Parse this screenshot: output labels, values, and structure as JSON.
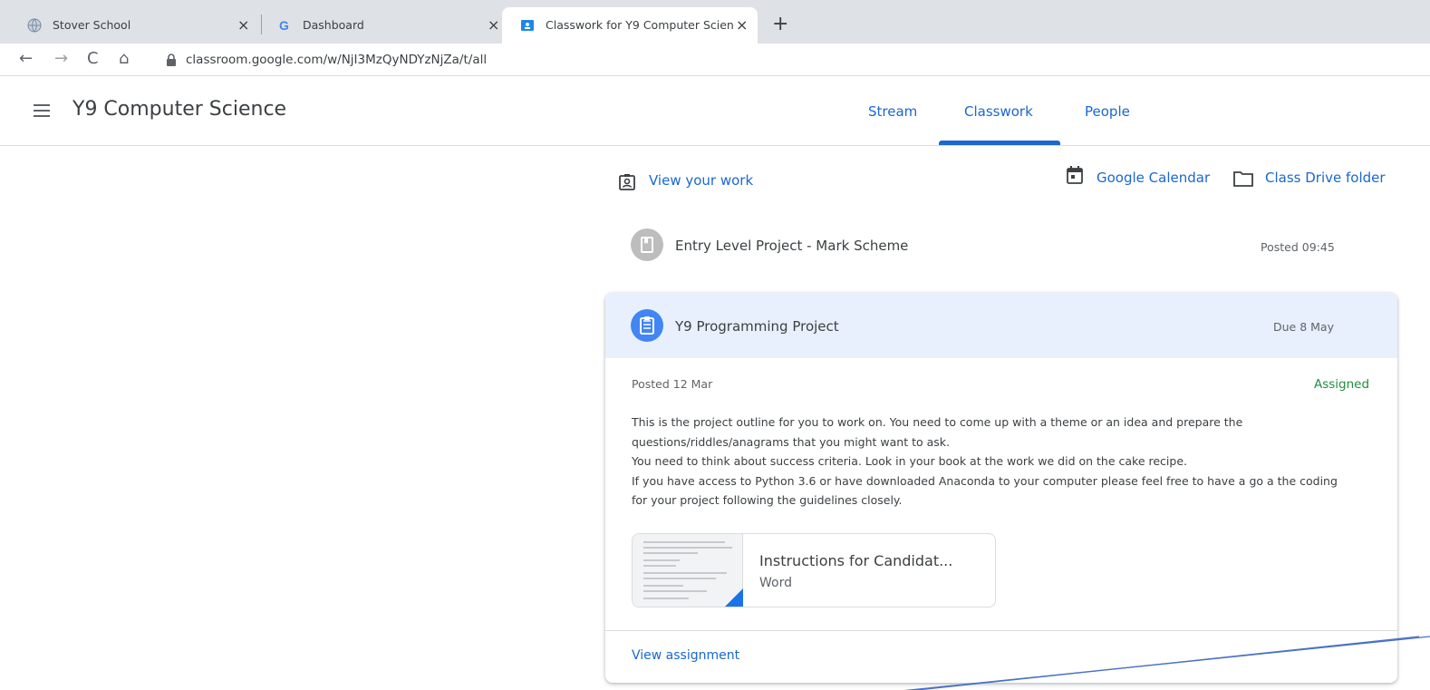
{
  "browser": {
    "tabs": [
      {
        "title": "Stover School",
        "favicon": "globe-icon"
      },
      {
        "title": "Dashboard",
        "favicon": "google-g-icon"
      },
      {
        "title": "Classwork for Y9 Computer Scien",
        "favicon": "classroom-icon"
      }
    ],
    "close_glyph": "×",
    "newtab_glyph": "+",
    "url": "classroom.google.com/w/NjI3MzQyNDYzNjZa/t/all",
    "nav": {
      "back": "←",
      "forward": "→",
      "reload": "C",
      "home": "⌂"
    }
  },
  "header": {
    "class_title": "Y9 Computer Science",
    "tabs": [
      {
        "label": "Stream"
      },
      {
        "label": "Classwork",
        "active": true
      },
      {
        "label": "People"
      }
    ]
  },
  "toolbar": {
    "view_work": "View your work",
    "calendar": "Google Calendar",
    "drive": "Class Drive folder"
  },
  "material": {
    "title": "Entry Level Project - Mark Scheme",
    "posted": "Posted 09:45"
  },
  "assignment": {
    "title": "Y9 Programming Project",
    "due": "Due 8 May",
    "posted": "Posted 12 Mar",
    "status": "Assigned",
    "description": [
      "This is the project outline for you to work on. You need to come up with a theme or an idea and prepare the",
      "questions/riddles/anagrams that you might want to ask.",
      "You need to think about success criteria. Look in your book at the work we did on the cake recipe.",
      "If you have access to Python 3.6 or have downloaded Anaconda to your computer please feel free to have a go a the coding",
      "for your project following the guidelines closely."
    ],
    "attachment": {
      "title": "Instructions for Candidat...",
      "type": "Word"
    },
    "view_label": "View assignment"
  },
  "colors": {
    "accent": "#1967d2",
    "assigned_green": "#1e8e3e",
    "card_header": "#e8f0fe",
    "material_icon_bg": "#bdbdbd",
    "assignment_icon_bg": "#4285f4",
    "annotation_arrow": "#4a72c4"
  }
}
